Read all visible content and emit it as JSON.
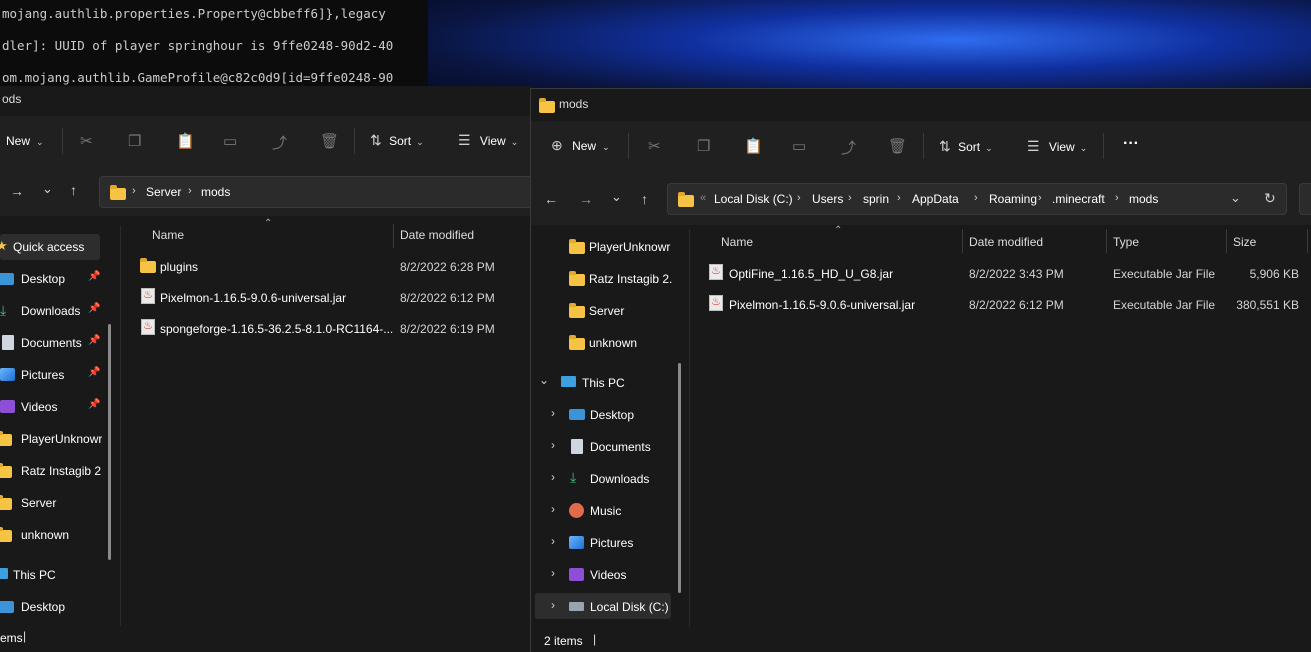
{
  "terminal": {
    "lines": [
      "mojang.authlib.properties.Property@cbbeff6]},legacy",
      "dler]: UUID of player springhour is 9ffe0248-90d2-40",
      "om.mojang.authlib.GameProfile@c82c0d9[id=9ffe0248-90"
    ]
  },
  "left_window": {
    "title": "ods",
    "toolbar": {
      "new": "New",
      "sort": "Sort",
      "view": "View"
    },
    "breadcrumb": [
      "Server",
      "mods"
    ],
    "columns": {
      "name": "Name",
      "date": "Date modified"
    },
    "files": [
      {
        "name": "plugins",
        "date": "8/2/2022 6:28 PM",
        "icon": "folder-icon"
      },
      {
        "name": "Pixelmon-1.16.5-9.0.6-universal.jar",
        "date": "8/2/2022 6:12 PM",
        "icon": "jar-icon"
      },
      {
        "name": "spongeforge-1.16.5-36.2.5-8.1.0-RC1164-...",
        "date": "8/2/2022 6:19 PM",
        "icon": "jar-icon"
      }
    ],
    "nav": [
      {
        "label": "Quick access",
        "icon": "star-icon"
      },
      {
        "label": "Desktop",
        "icon": "desktop-icon",
        "pinned": true
      },
      {
        "label": "Downloads",
        "icon": "download-icon",
        "pinned": true
      },
      {
        "label": "Documents",
        "icon": "documents-icon",
        "pinned": true
      },
      {
        "label": "Pictures",
        "icon": "pictures-icon",
        "pinned": true
      },
      {
        "label": "Videos",
        "icon": "videos-icon",
        "pinned": true
      },
      {
        "label": "PlayerUnknowr",
        "icon": "folder-icon"
      },
      {
        "label": "Ratz Instagib 2.",
        "icon": "folder-icon"
      },
      {
        "label": "Server",
        "icon": "folder-icon"
      },
      {
        "label": "unknown",
        "icon": "folder-icon"
      },
      {
        "label": "This PC",
        "icon": "pc-icon"
      },
      {
        "label": "Desktop",
        "icon": "desktop-icon"
      }
    ],
    "status": "ems"
  },
  "right_window": {
    "title": "mods",
    "toolbar": {
      "new": "New",
      "sort": "Sort",
      "view": "View",
      "more": "···"
    },
    "breadcrumb": [
      "Local Disk (C:)",
      "Users",
      "sprin",
      "AppData",
      "Roaming",
      ".minecraft",
      "mods"
    ],
    "columns": {
      "name": "Name",
      "date": "Date modified",
      "type": "Type",
      "size": "Size"
    },
    "files": [
      {
        "name": "OptiFine_1.16.5_HD_U_G8.jar",
        "date": "8/2/2022 3:43 PM",
        "type": "Executable Jar File",
        "size": "5,906 KB"
      },
      {
        "name": "Pixelmon-1.16.5-9.0.6-universal.jar",
        "date": "8/2/2022 6:12 PM",
        "type": "Executable Jar File",
        "size": "380,551 KB"
      }
    ],
    "nav_folders": [
      "PlayerUnknowr",
      "Ratz Instagib 2.",
      "Server",
      "unknown"
    ],
    "this_pc": "This PC",
    "pc_items": [
      {
        "label": "Desktop",
        "icon": "desktop-icon"
      },
      {
        "label": "Documents",
        "icon": "documents-icon"
      },
      {
        "label": "Downloads",
        "icon": "download-icon"
      },
      {
        "label": "Music",
        "icon": "music-icon"
      },
      {
        "label": "Pictures",
        "icon": "pictures-icon"
      },
      {
        "label": "Videos",
        "icon": "videos-icon"
      },
      {
        "label": "Local Disk (C:)",
        "icon": "drive-icon"
      }
    ],
    "status": "2 items"
  }
}
